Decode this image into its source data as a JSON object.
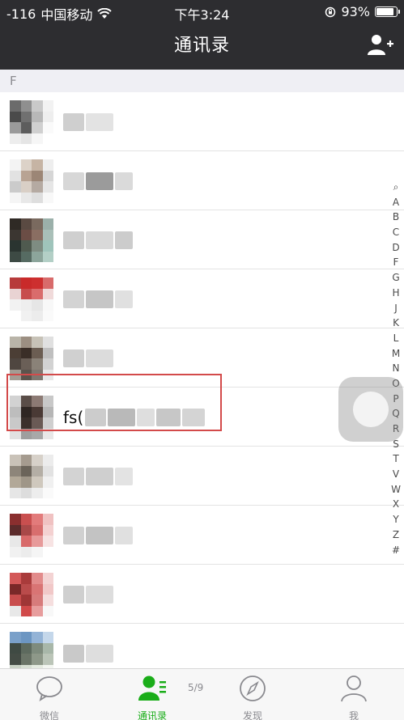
{
  "status_bar": {
    "signal": "-116",
    "carrier": "中国移动",
    "time": "下午3:24",
    "battery": "93%",
    "battery_level": 0.93
  },
  "nav": {
    "title": "通讯录",
    "add_icon": "add-contact-icon"
  },
  "section_letter": "F",
  "contacts": [
    {
      "name_prefix": "",
      "avatar": [
        "#6b6b6b",
        "#8f8f8f",
        "#c9c9c9",
        "#f2f2f2",
        "#4a4a4a",
        "#707070",
        "#b8b8b8",
        "#eeeeee",
        "#9a9a9a",
        "#5d5d5d",
        "#d0d0d0",
        "#fafafa",
        "#ededed",
        "#e5e5e5",
        "#f6f6f6",
        "#ffffff"
      ],
      "blur": [
        "#cfcfcf",
        "#e3e3e3"
      ]
    },
    {
      "name_prefix": "",
      "avatar": [
        "#f3f3f3",
        "#dcd2c8",
        "#c6b4a4",
        "#eeeeee",
        "#e2e2e2",
        "#b8a393",
        "#9c8676",
        "#d6d6d6",
        "#cbcbcb",
        "#d9cfc6",
        "#b5aaa2",
        "#e6e6e6",
        "#f5f5f5",
        "#e8e8e8",
        "#dedede",
        "#f8f8f8"
      ],
      "blur": [
        "#d7d7d7",
        "#9b9b9b",
        "#dadada"
      ]
    },
    {
      "name_prefix": "",
      "avatar": [
        "#2f2a25",
        "#5a4a42",
        "#7a6a5f",
        "#9bb0aa",
        "#3b3631",
        "#6b4d45",
        "#8a6e62",
        "#a9bfb8",
        "#2a3430",
        "#4f5a4f",
        "#7e8c82",
        "#9fc4bb",
        "#3d4a44",
        "#566b62",
        "#8ca59b",
        "#b3cfc6"
      ],
      "blur": [
        "#cfcfcf",
        "#d9d9d9",
        "#cccccc"
      ]
    },
    {
      "name_prefix": "",
      "avatar": [
        "#b73b3b",
        "#c92a2a",
        "#cd2f2f",
        "#d86b6b",
        "#e9d3d3",
        "#c74d4d",
        "#d96c6c",
        "#f0dada",
        "#f2f2f2",
        "#eeeeee",
        "#e6e6e6",
        "#f8f8f8",
        "#ffffff",
        "#f1f1f1",
        "#ececec",
        "#fafafa"
      ],
      "blur": [
        "#d3d3d3",
        "#c6c6c6",
        "#e0e0e0"
      ]
    },
    {
      "name_prefix": "",
      "avatar": [
        "#b9b4a8",
        "#9c8f82",
        "#c7c2b7",
        "#e0e0e0",
        "#4b3e35",
        "#3a2e27",
        "#6b5d52",
        "#bfbfbf",
        "#4f4640",
        "#6a5f57",
        "#8a8278",
        "#d2d2d2",
        "#a39c94",
        "#5b544d",
        "#7e7770",
        "#e8e8e8"
      ],
      "blur": [
        "#d0d0d0",
        "#dcdcdc"
      ]
    },
    {
      "name_prefix": "fs(",
      "avatar": [
        "#d2d2d2",
        "#5a4d48",
        "#8c7a74",
        "#c8c8c8",
        "#bdbdbd",
        "#2f2623",
        "#4a3a35",
        "#b6b6b6",
        "#c9c9c9",
        "#3b302c",
        "#6a5a55",
        "#cfcfcf",
        "#e1e1e1",
        "#9e9e9e",
        "#a8a8a8",
        "#e8e8e8"
      ],
      "blur": [
        "#cccccc",
        "#b9b9b9",
        "#dedede",
        "#c7c7c7",
        "#d4d4d4"
      ]
    },
    {
      "name_prefix": "",
      "avatar": [
        "#c9c2b8",
        "#a59b8f",
        "#d7d1c9",
        "#ececec",
        "#8d857a",
        "#6b645a",
        "#b4aea5",
        "#e2e2e2",
        "#b2a898",
        "#9f9688",
        "#cfc8bd",
        "#f0f0f0",
        "#e6e6e6",
        "#dddddd",
        "#ededed",
        "#fafafa"
      ],
      "blur": [
        "#d3d3d3",
        "#cfcfcf",
        "#e3e3e3"
      ]
    },
    {
      "name_prefix": "",
      "avatar": [
        "#8a2f2f",
        "#c94f4f",
        "#e27b7b",
        "#f0c2c2",
        "#5b2b2b",
        "#a84848",
        "#d86e6e",
        "#f4d1d1",
        "#e8e8e8",
        "#d86a6a",
        "#e79a9a",
        "#f7e3e3",
        "#f1f1f1",
        "#ececec",
        "#f5f5f5",
        "#ffffff"
      ],
      "blur": [
        "#d0d0d0",
        "#c3c3c3",
        "#e0e0e0"
      ]
    },
    {
      "name_prefix": "",
      "avatar": [
        "#d35858",
        "#a93b3b",
        "#e28b8b",
        "#f3d3d3",
        "#7a2828",
        "#b94b4b",
        "#d97474",
        "#f1c8c8",
        "#c84d4d",
        "#9f3636",
        "#d77b7b",
        "#f5dede",
        "#e8e8e8",
        "#d04a4a",
        "#e79d9d",
        "#f8f8f8"
      ],
      "blur": [
        "#cfcfcf",
        "#dddddd"
      ]
    },
    {
      "name_prefix": "",
      "avatar": [
        "#7aa0c9",
        "#6c96c2",
        "#93b3d6",
        "#c4d7ea",
        "#3f4a43",
        "#5d6a5e",
        "#7e8b7d",
        "#a8b7a9",
        "#444c45",
        "#6a7467",
        "#8e9889",
        "#bbc5b8",
        "#c9d2c5",
        "#d7dfd3",
        "#e5ebe1",
        "#f3f6f1"
      ],
      "blur": [
        "#c9c9c9",
        "#dedede"
      ]
    }
  ],
  "index_letters": [
    "Q",
    "A",
    "B",
    "C",
    "D",
    "F",
    "G",
    "H",
    "J",
    "K",
    "L",
    "M",
    "N",
    "O",
    "P",
    "Q",
    "R",
    "S",
    "T",
    "V",
    "W",
    "X",
    "Y",
    "Z",
    "#"
  ],
  "tabs": [
    {
      "label": "微信",
      "icon": "chat-bubble-icon",
      "active": false
    },
    {
      "label": "通讯录",
      "icon": "contacts-icon",
      "active": true
    },
    {
      "label": "发现",
      "icon": "compass-icon",
      "active": false
    },
    {
      "label": "我",
      "icon": "person-icon",
      "active": false
    }
  ],
  "pager": "5/9",
  "colors": {
    "nav_bg": "#2d2d30",
    "accent": "#1aad19",
    "highlight": "#d34a4a"
  }
}
